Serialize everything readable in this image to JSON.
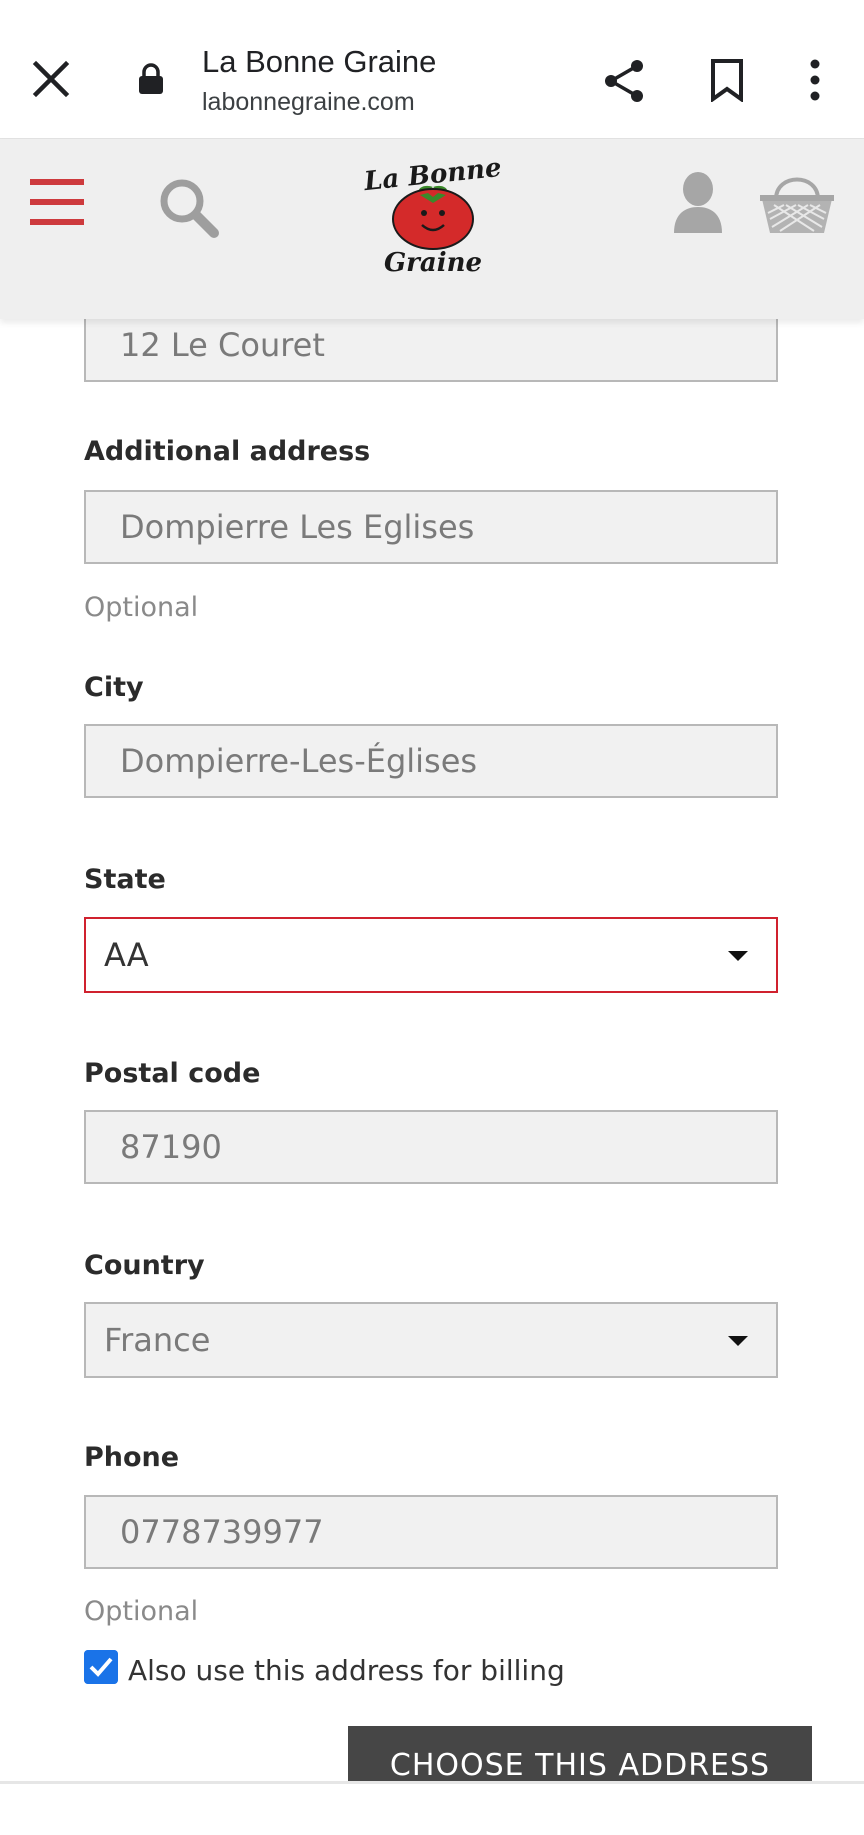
{
  "browser": {
    "title": "La Bonne Graine",
    "url": "labonnegraine.com"
  },
  "header": {
    "logo_top": "La Bonne",
    "logo_bottom": "Graine"
  },
  "form": {
    "address_value": "12 Le Couret",
    "additional_address_label": "Additional address",
    "additional_address_value": "Dompierre Les Eglises",
    "optional_1": "Optional",
    "city_label": "City",
    "city_value": "Dompierre-Les-Églises",
    "state_label": "State",
    "state_value": "AA",
    "postal_label": "Postal code",
    "postal_value": "87190",
    "country_label": "Country",
    "country_value": "France",
    "phone_label": "Phone",
    "phone_value": "0778739977",
    "optional_2": "Optional",
    "billing_label": "Also use this address for billing",
    "billing_checked": true,
    "submit_label": "CHOOSE THIS ADDRESS"
  },
  "colors": {
    "accent_red": "#d0212e",
    "checkbox_blue": "#1a73e8",
    "button_dark": "#464646"
  }
}
